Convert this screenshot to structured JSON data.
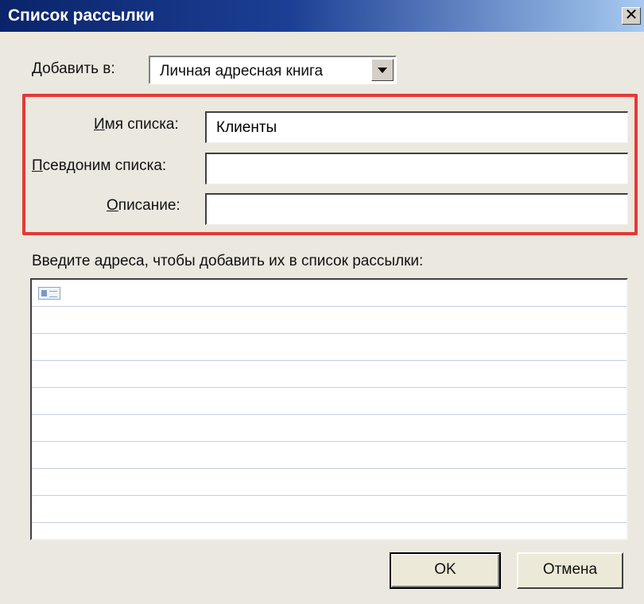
{
  "dialog": {
    "title": "Список рассылки",
    "close_glyph": "✕"
  },
  "add_to": {
    "label_accel": "Д",
    "label_rest": "обавить в:",
    "selected": "Личная адресная книга"
  },
  "fields": {
    "list_name": {
      "label_accel": "И",
      "label_rest": "мя списка:",
      "value": "Клиенты"
    },
    "list_alias": {
      "label_accel": "П",
      "label_rest": "севдоним списка:",
      "value": ""
    },
    "description": {
      "label_accel": "О",
      "label_rest": "писание:",
      "value": ""
    }
  },
  "addresses": {
    "prompt": "Введите адреса, чтобы добавить их в список рассылки:",
    "row_icon": "contact-card-icon"
  },
  "buttons": {
    "ok": "OK",
    "cancel": "Отмена"
  },
  "colors": {
    "titlebar_start": "#0a246a",
    "titlebar_end": "#a6caf0",
    "highlight": "#e53935",
    "dialog_bg": "#ebe8e0"
  }
}
